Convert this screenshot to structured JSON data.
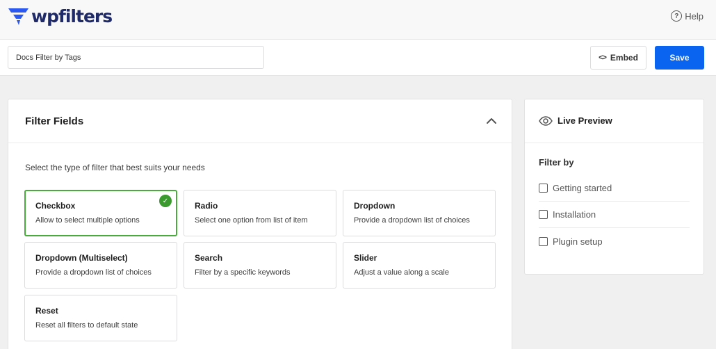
{
  "brand": {
    "logo_text": "wpfilters",
    "logo_color": "#1f2a6b",
    "icon_color": "#2b59f0"
  },
  "header": {
    "help_label": "Help"
  },
  "toolbar": {
    "filter_name": "Docs Filter by Tags",
    "embed_label": "Embed",
    "save_label": "Save",
    "accent": "#0a64f0"
  },
  "fields": {
    "title": "Filter Fields",
    "description": "Select the type of filter that best suits your needs",
    "cards": [
      {
        "title": "Checkbox",
        "desc": "Allow to select multiple options",
        "selected": true
      },
      {
        "title": "Radio",
        "desc": "Select one option from list of item",
        "selected": false
      },
      {
        "title": "Dropdown",
        "desc": "Provide a dropdown list of choices",
        "selected": false
      },
      {
        "title": "Dropdown (Multiselect)",
        "desc": "Provide a dropdown list of choices",
        "selected": false
      },
      {
        "title": "Search",
        "desc": "Filter by a specific keywords",
        "selected": false
      },
      {
        "title": "Slider",
        "desc": "Adjust a value along a scale",
        "selected": false
      },
      {
        "title": "Reset",
        "desc": "Reset all filters to default state",
        "selected": false
      }
    ]
  },
  "preview": {
    "title": "Live Preview",
    "filter_by": "Filter by",
    "options": [
      {
        "label": "Getting started",
        "checked": false
      },
      {
        "label": "Installation",
        "checked": false
      },
      {
        "label": "Plugin setup",
        "checked": false
      }
    ]
  }
}
